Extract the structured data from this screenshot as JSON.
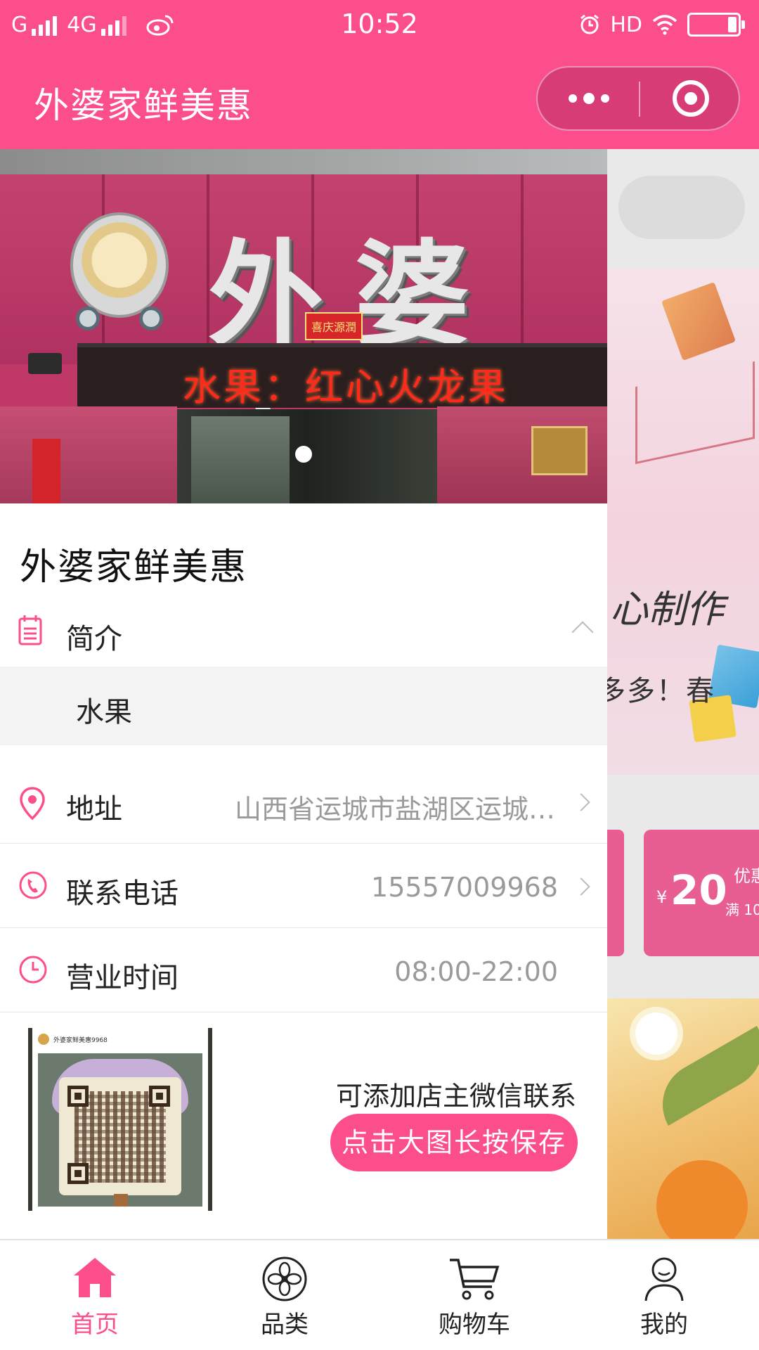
{
  "status_bar": {
    "carrier1": "G",
    "network": "4G",
    "time": "10:52",
    "hd": "HD",
    "battery_level": 0.15
  },
  "nav": {
    "title": "外婆家鲜美惠",
    "more_icon": "more-dots-icon",
    "close_icon": "close-target-icon"
  },
  "background": {
    "notice_text": "多多！春",
    "coupon": {
      "currency": "¥",
      "amount": "20",
      "label": "优惠",
      "sub": "满 10"
    }
  },
  "store": {
    "photo": {
      "sign_text": "外婆家",
      "led_text": "水果：红心火龙果",
      "tag_text": "喜庆源潤",
      "carousel_dots": 1,
      "active_dot": 1
    },
    "name": "外婆家鲜美惠",
    "intro": {
      "label": "简介",
      "content": "水果",
      "expanded": true,
      "icon": "calendar-icon"
    },
    "address": {
      "label": "地址",
      "value": "山西省运城市盐湖区运城市盐湖区",
      "icon": "location-pin-icon"
    },
    "phone": {
      "label": "联系电话",
      "value": "15557009968",
      "icon": "phone-icon"
    },
    "hours": {
      "label": "营业时间",
      "value": "08:00-22:00",
      "icon": "clock-icon"
    },
    "wechat": {
      "qr_header": "外婆家鲜美惠9968",
      "note": "可添加店主微信联系",
      "save_button": "点击大图长按保存"
    }
  },
  "tabbar": {
    "items": [
      {
        "label": "首页",
        "icon": "home-icon",
        "active": true
      },
      {
        "label": "品类",
        "icon": "category-flower-icon",
        "active": false
      },
      {
        "label": "购物车",
        "icon": "cart-icon",
        "active": false
      },
      {
        "label": "我的",
        "icon": "profile-icon",
        "active": false
      }
    ]
  },
  "colors": {
    "accent": "#fc4e8c",
    "text_primary": "#222222",
    "text_secondary": "#9a9a9a",
    "intro_bg": "#f3f3f3"
  }
}
